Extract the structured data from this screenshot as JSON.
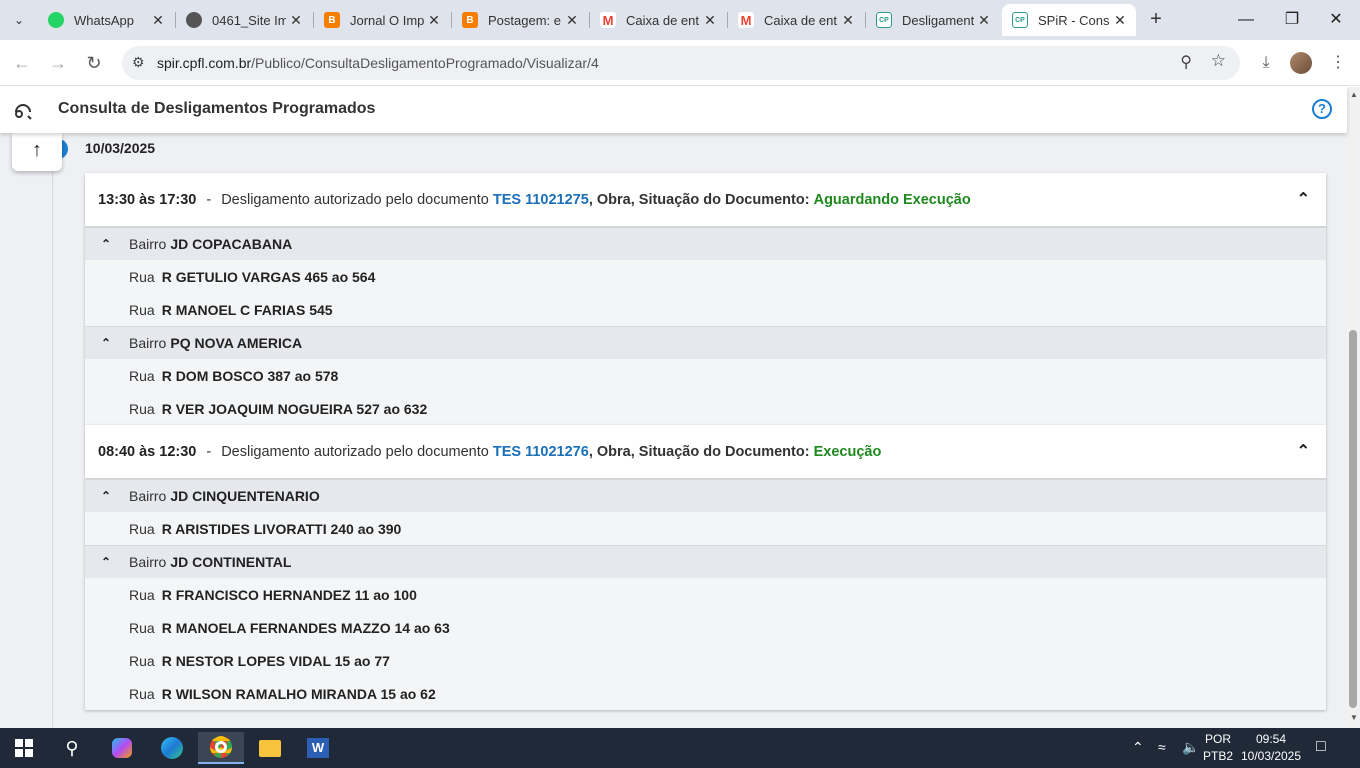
{
  "browser": {
    "tabs": [
      {
        "title": "WhatsApp",
        "favicon": "whatsapp-icon",
        "color": "#25d366"
      },
      {
        "title": "0461_Site Im",
        "favicon": "globe-icon",
        "color": "#555555"
      },
      {
        "title": "Jornal O Imp",
        "favicon": "blogger-icon",
        "color": "#f57d00"
      },
      {
        "title": "Postagem: e",
        "favicon": "blogger-icon",
        "color": "#f57d00"
      },
      {
        "title": "Caixa de ent",
        "favicon": "gmail-icon",
        "color": "#ea4335"
      },
      {
        "title": "Caixa de ent",
        "favicon": "gmail-icon",
        "color": "#ea4335"
      },
      {
        "title": "Desligament",
        "favicon": "cpfl-icon",
        "color": "#2a9d8f"
      },
      {
        "title": "SPiR - Consu",
        "favicon": "cpfl-icon",
        "color": "#2a9d8f"
      }
    ],
    "url_host": "spir.cpfl.com.br",
    "url_path": "/Publico/ConsultaDesligamentoProgramado/Visualizar/4"
  },
  "app": {
    "title": "Consulta de Desligamentos Programados",
    "help": "?"
  },
  "page": {
    "date": "10/03/2025",
    "labels": {
      "range_sep": "-",
      "authorized": "Desligamento autorizado pelo documento",
      "obra": ", Obra, Situação do Documento:",
      "bairro": "Bairro",
      "rua": "Rua"
    },
    "outages": [
      {
        "time": "13:30 às 17:30",
        "document": "TES 11021275",
        "status": "Aguardando Execução",
        "bairros": [
          {
            "name": "JD COPACABANA",
            "ruas": [
              "R GETULIO VARGAS 465 ao 564",
              "R MANOEL C FARIAS 545"
            ]
          },
          {
            "name": "PQ NOVA AMERICA",
            "ruas": [
              "R DOM BOSCO 387 ao 578",
              "R VER JOAQUIM NOGUEIRA 527 ao 632"
            ]
          }
        ]
      },
      {
        "time": "08:40 às 12:30",
        "document": "TES 11021276",
        "status": "Execução",
        "bairros": [
          {
            "name": "JD CINQUENTENARIO",
            "ruas": [
              "R ARISTIDES LIVORATTI 240 ao 390"
            ]
          },
          {
            "name": "JD CONTINENTAL",
            "ruas": [
              "R FRANCISCO HERNANDEZ 11 ao 100",
              "R MANOELA FERNANDES MAZZO 14 ao 63",
              "R NESTOR LOPES VIDAL 15 ao 77",
              "R WILSON RAMALHO MIRANDA 15 ao 62"
            ]
          }
        ]
      }
    ]
  },
  "taskbar": {
    "lang": "POR",
    "layout": "PTB2",
    "time": "09:54",
    "date": "10/03/2025"
  }
}
